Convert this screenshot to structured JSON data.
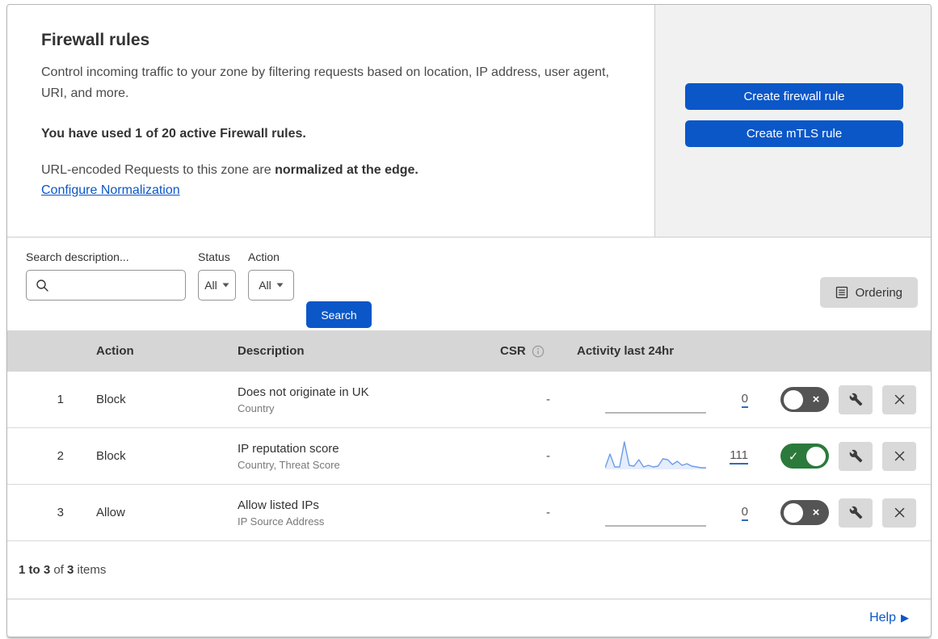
{
  "header": {
    "title": "Firewall rules",
    "description": "Control incoming traffic to your zone by filtering requests based on location, IP address, user agent, URI, and more.",
    "usage": "You have used 1 of 20 active Firewall rules.",
    "norm_prefix": "URL-encoded Requests to this zone are ",
    "norm_bold": "normalized at the edge.",
    "norm_link": "Configure Normalization",
    "buttons": [
      {
        "label": "Create firewall rule"
      },
      {
        "label": "Create mTLS rule"
      }
    ]
  },
  "filters": {
    "search_label": "Search description...",
    "status_label": "Status",
    "status_value": "All",
    "action_label": "Action",
    "action_value": "All",
    "search_button": "Search",
    "ordering_button": "Ordering"
  },
  "table": {
    "columns": {
      "action": "Action",
      "description": "Description",
      "csr": "CSR",
      "activity": "Activity last 24hr"
    },
    "rows": [
      {
        "index": "1",
        "action": "Block",
        "description": "Does not originate in UK",
        "criteria": "Country",
        "csr": "-",
        "activity_count": "0",
        "enabled": false,
        "sparkline": null
      },
      {
        "index": "2",
        "action": "Block",
        "description": "IP reputation score",
        "criteria": "Country, Threat Score",
        "csr": "-",
        "activity_count": "111",
        "enabled": true,
        "sparkline": [
          2,
          19,
          3,
          3,
          34,
          5,
          4,
          12,
          3,
          5,
          3,
          4,
          13,
          12,
          6,
          10,
          5,
          7,
          4,
          3,
          2,
          2
        ]
      },
      {
        "index": "3",
        "action": "Allow",
        "description": "Allow listed IPs",
        "criteria": "IP Source Address",
        "csr": "-",
        "activity_count": "0",
        "enabled": false,
        "sparkline": null
      }
    ]
  },
  "footer": {
    "range": "1 to 3",
    "of": " of ",
    "total": "3",
    "items": " items",
    "help": "Help"
  },
  "colors": {
    "accent": "#0b57c8",
    "link": "#0b57c8",
    "panel": "#f1f1f1",
    "band": "#d6d6d6",
    "btngray": "#d9d9d9",
    "toggleon": "#2b7a3c",
    "toggleoff": "#545454",
    "sparkline": "#6e9be9",
    "sparkflat": "#9e9e9e",
    "underl": "#2f6db8"
  }
}
